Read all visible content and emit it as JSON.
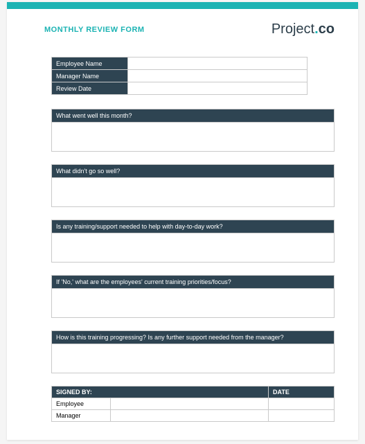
{
  "header": {
    "title": "MONTHLY REVIEW FORM",
    "logo_light": "Project",
    "logo_dot": ".",
    "logo_bold": "co"
  },
  "info": {
    "rows": [
      {
        "label": "Employee Name",
        "value": ""
      },
      {
        "label": "Manager Name",
        "value": ""
      },
      {
        "label": "Review Date",
        "value": ""
      }
    ]
  },
  "sections": [
    {
      "question": "What went well this month?",
      "answer": ""
    },
    {
      "question": "What didn't go so well?",
      "answer": ""
    },
    {
      "question": "Is any training/support needed to help with day-to-day work?",
      "answer": ""
    },
    {
      "question": "If 'No,' what are the employees' current training priorities/focus?",
      "answer": ""
    },
    {
      "question": "How is this training progressing? Is any further support needed from the manager?",
      "answer": ""
    }
  ],
  "signoff": {
    "header_signed": "SIGNED BY:",
    "header_date": "DATE",
    "rows": [
      {
        "label": "Employee",
        "signature": "",
        "date": ""
      },
      {
        "label": "Manager",
        "signature": "",
        "date": ""
      }
    ]
  }
}
